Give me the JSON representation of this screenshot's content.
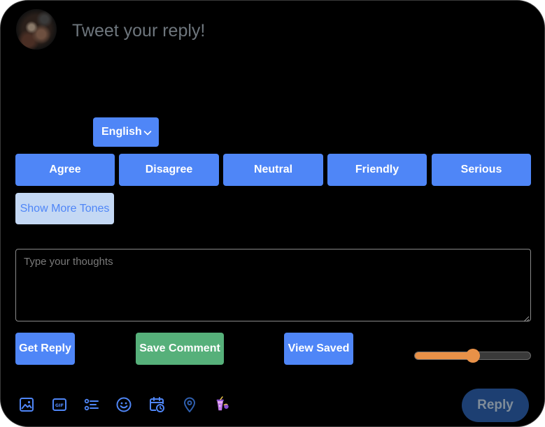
{
  "compose": {
    "placeholder": "Tweet your reply!"
  },
  "language": {
    "selected": "English"
  },
  "tones": [
    {
      "label": "Agree"
    },
    {
      "label": "Disagree"
    },
    {
      "label": "Neutral"
    },
    {
      "label": "Friendly"
    },
    {
      "label": "Serious"
    }
  ],
  "show_more_label": "Show More Tones",
  "thoughts": {
    "placeholder": "Type your thoughts",
    "value": ""
  },
  "actions": {
    "get_reply": "Get Reply",
    "save_comment": "Save Comment",
    "view_saved": "View Saved"
  },
  "slider": {
    "value": 0.5,
    "fill_color": "#e89148"
  },
  "toolbar": {
    "icons": [
      "image-icon",
      "gif-icon",
      "poll-icon",
      "emoji-icon",
      "schedule-icon",
      "location-icon",
      "ai-assistant-icon"
    ]
  },
  "reply_label": "Reply",
  "colors": {
    "background": "#000000",
    "primary": "#4f86f7",
    "success": "#56b07a",
    "accent": "#e89148",
    "reply_disabled": "#1d3f72",
    "icon": "#4f86f7"
  }
}
